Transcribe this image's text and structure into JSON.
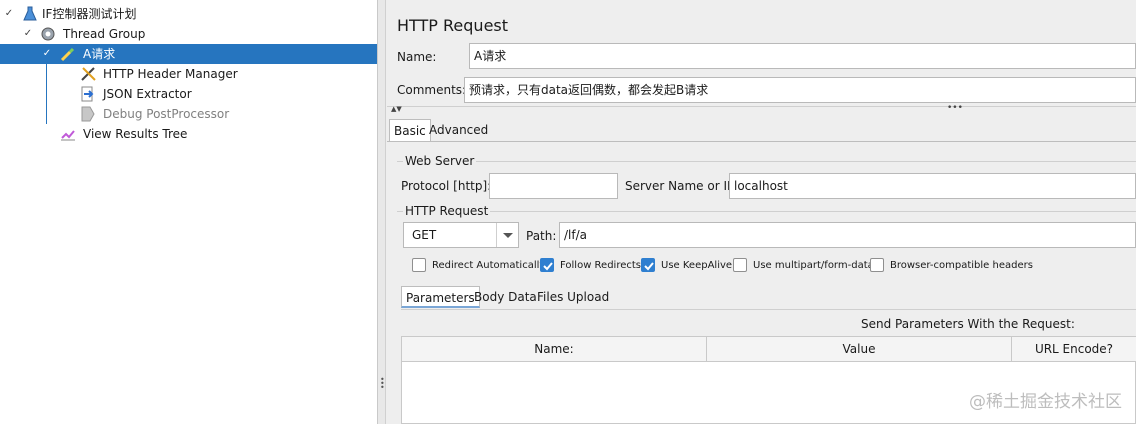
{
  "tree": {
    "plan": "IF控制器测试计划",
    "thread_group": "Thread Group",
    "request": "A请求",
    "header_manager": "HTTP Header Manager",
    "json_extractor": "JSON Extractor",
    "debug_post": "Debug PostProcessor",
    "results_tree": "View Results Tree"
  },
  "panel": {
    "title": "HTTP Request",
    "name_label": "Name:",
    "name_value": "A请求",
    "comments_label": "Comments:",
    "comments_value": "预请求，只有data返回偶数，都会发起B请求",
    "tab_basic": "Basic",
    "tab_advanced": "Advanced",
    "web_server_title": "Web Server",
    "protocol_label": "Protocol [http]:",
    "protocol_value": "",
    "server_label": "Server Name or IP:",
    "server_value": "localhost",
    "http_request_title": "HTTP Request",
    "method_value": "GET",
    "path_label": "Path:",
    "path_value": "/lf/a",
    "checkboxes": [
      {
        "label": "Redirect Automatically",
        "checked": false
      },
      {
        "label": "Follow Redirects",
        "checked": true
      },
      {
        "label": "Use KeepAlive",
        "checked": true
      },
      {
        "label": "Use multipart/form-data",
        "checked": false
      },
      {
        "label": "Browser-compatible headers",
        "checked": false
      }
    ],
    "subtabs": [
      "Parameters",
      "Body Data",
      "Files Upload"
    ],
    "send_params": "Send Parameters With the Request:",
    "columns": [
      "Name:",
      "Value",
      "URL Encode?"
    ]
  },
  "watermark": "@稀土掘金技术社区",
  "colors": {
    "selection": "#2675bf",
    "checkbox_on": "#2f7fd0"
  }
}
